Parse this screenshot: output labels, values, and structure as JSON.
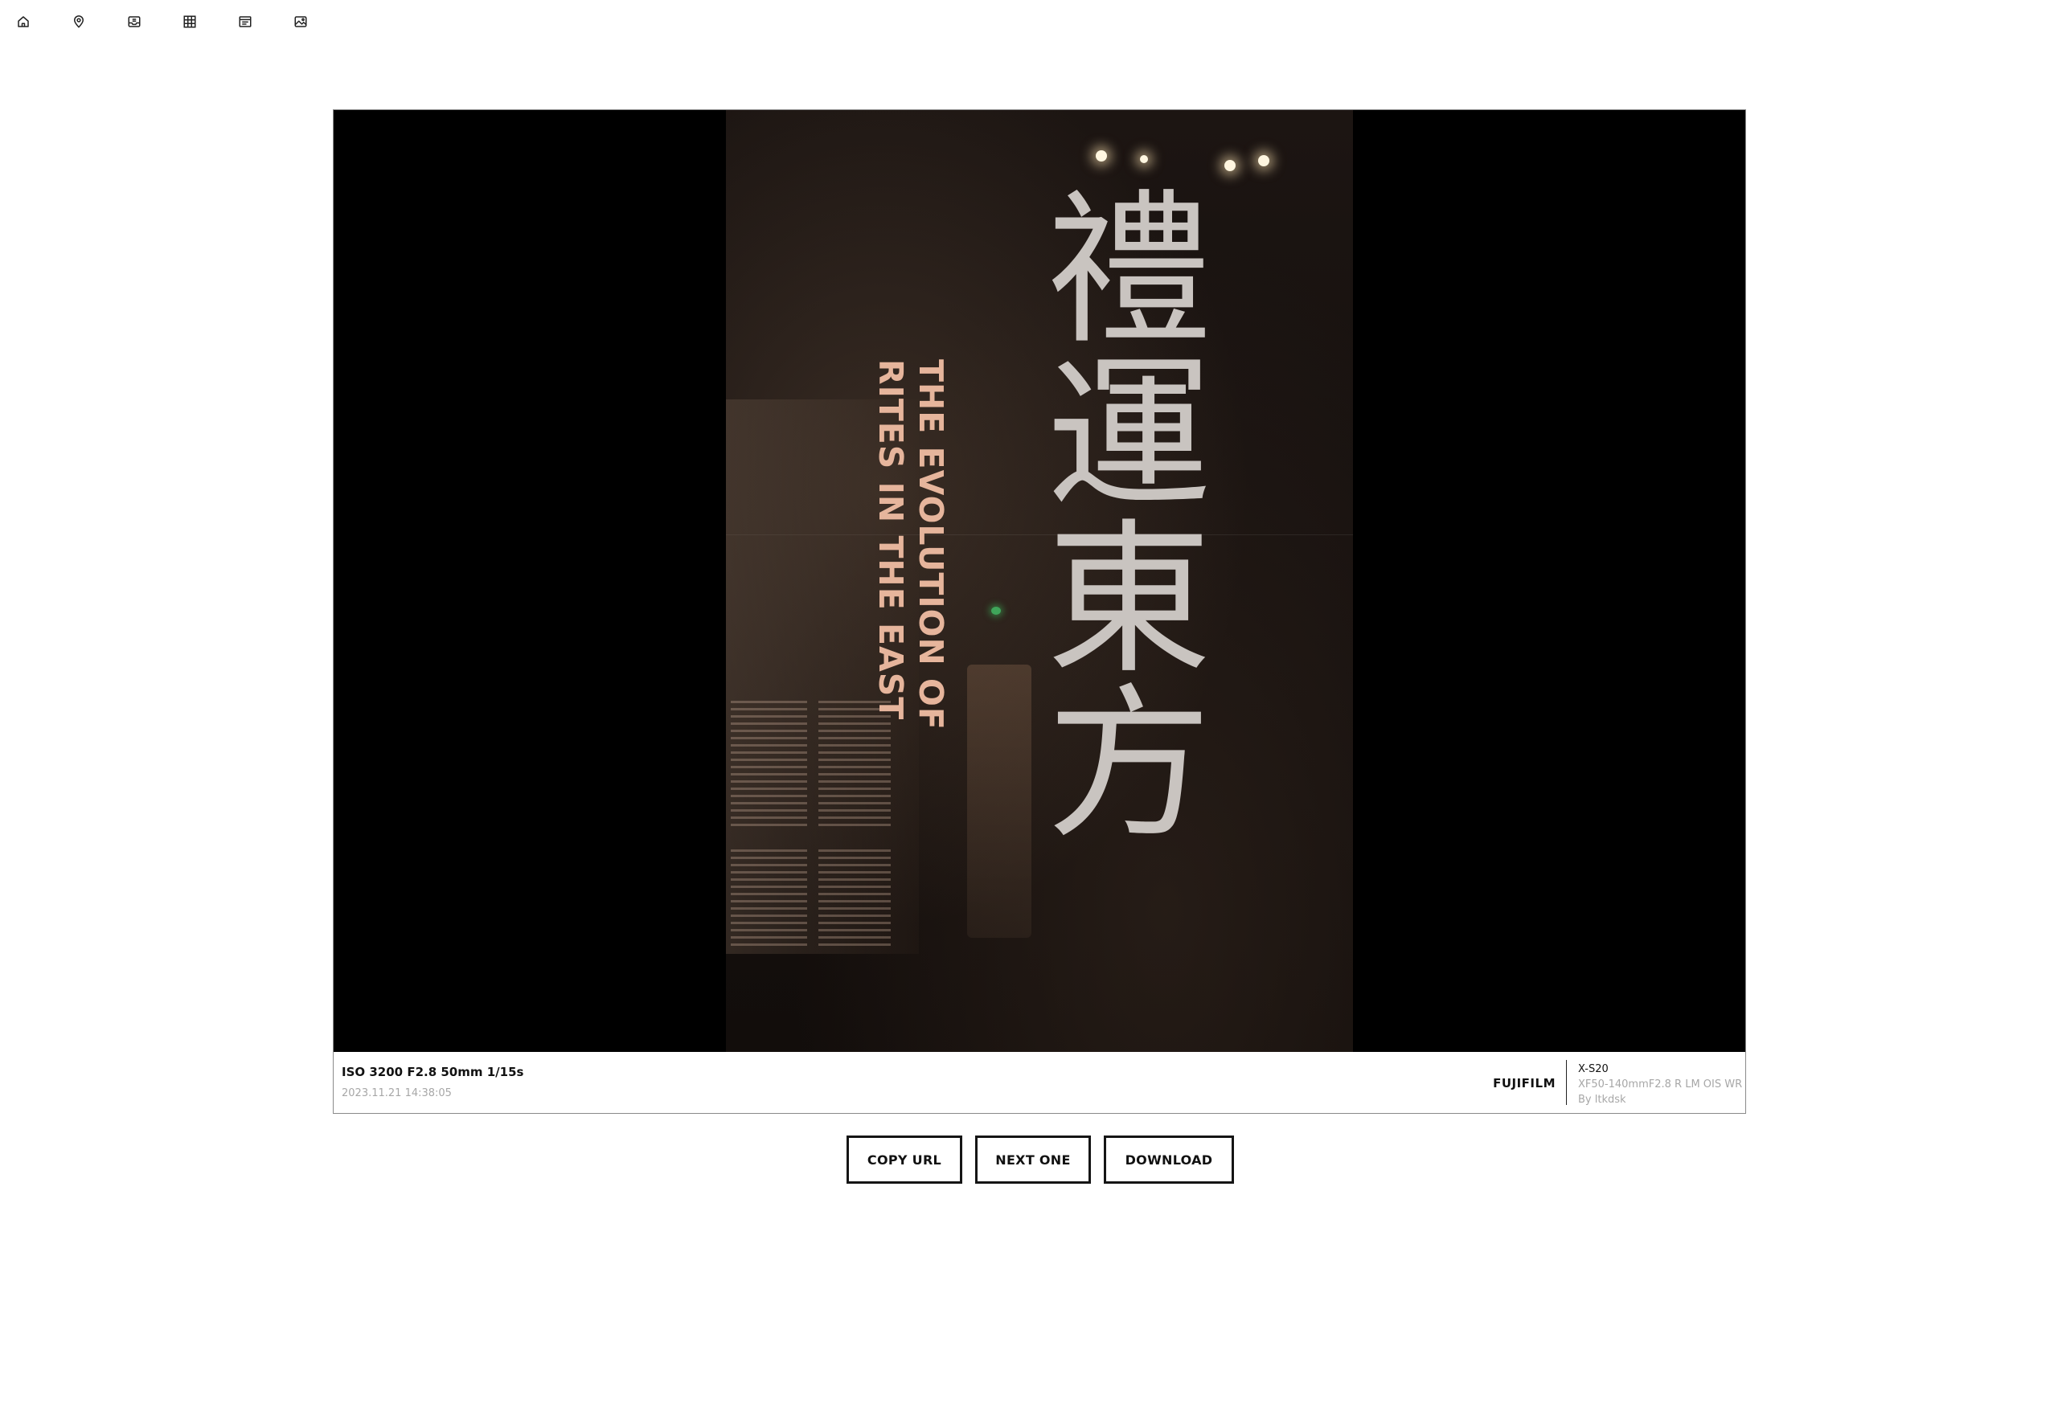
{
  "nav": {
    "items": [
      {
        "icon": "home-icon"
      },
      {
        "icon": "map-pin-icon"
      },
      {
        "icon": "inbox-icon"
      },
      {
        "icon": "grid-icon"
      },
      {
        "icon": "list-icon"
      },
      {
        "icon": "image-icon"
      }
    ]
  },
  "photo": {
    "sign_cjk": "禮運東方",
    "sign_en": "THE EVOLUTION OF\nRITES IN THE EAST"
  },
  "caption": {
    "exif": "ISO 3200 F2.8 50mm 1/15s",
    "datetime": "2023.11.21 14:38:05",
    "brand": "FUJIFILM",
    "model": "X-S20",
    "lens": "XF50-140mmF2.8 R LM OIS WR",
    "author": "By ltkdsk"
  },
  "actions": {
    "copy_url": "COPY URL",
    "next_one": "NEXT ONE",
    "download": "DOWNLOAD"
  }
}
